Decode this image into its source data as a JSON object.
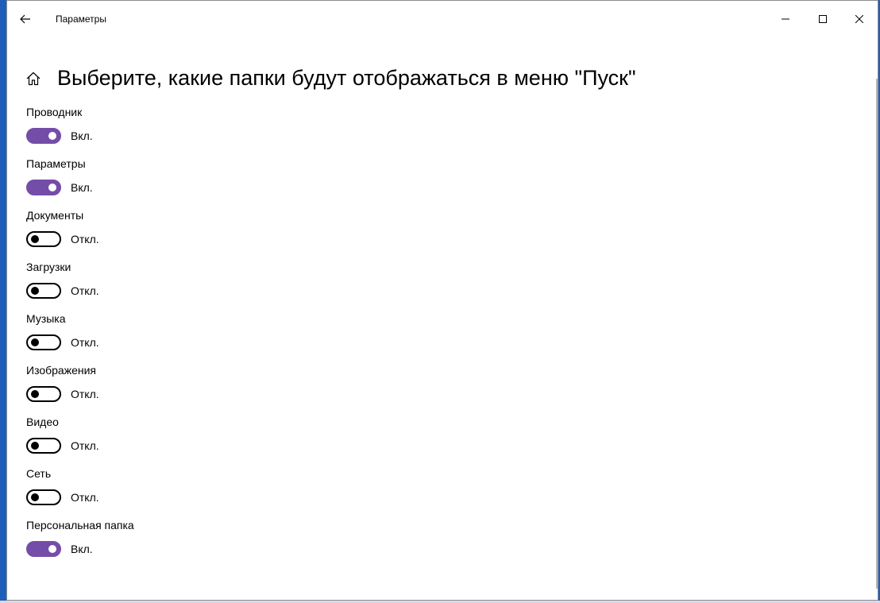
{
  "window": {
    "title": "Параметры"
  },
  "header": {
    "title": "Выберите, какие папки будут отображаться в меню \"Пуск\""
  },
  "settings": [
    {
      "label": "Проводник",
      "state": "on",
      "state_text": "Вкл."
    },
    {
      "label": "Параметры",
      "state": "on",
      "state_text": "Вкл."
    },
    {
      "label": "Документы",
      "state": "off",
      "state_text": "Откл."
    },
    {
      "label": "Загрузки",
      "state": "off",
      "state_text": "Откл."
    },
    {
      "label": "Музыка",
      "state": "off",
      "state_text": "Откл."
    },
    {
      "label": "Изображения",
      "state": "off",
      "state_text": "Откл."
    },
    {
      "label": "Видео",
      "state": "off",
      "state_text": "Откл."
    },
    {
      "label": "Сеть",
      "state": "off",
      "state_text": "Откл."
    },
    {
      "label": "Персональная папка",
      "state": "on",
      "state_text": "Вкл."
    }
  ],
  "colors": {
    "accent": "#744da9",
    "desktop": "#1d5fb8"
  },
  "icons": {
    "back": "back-arrow-icon",
    "home": "home-icon",
    "minimize": "minimize-icon",
    "maximize": "maximize-icon",
    "close": "close-icon"
  }
}
